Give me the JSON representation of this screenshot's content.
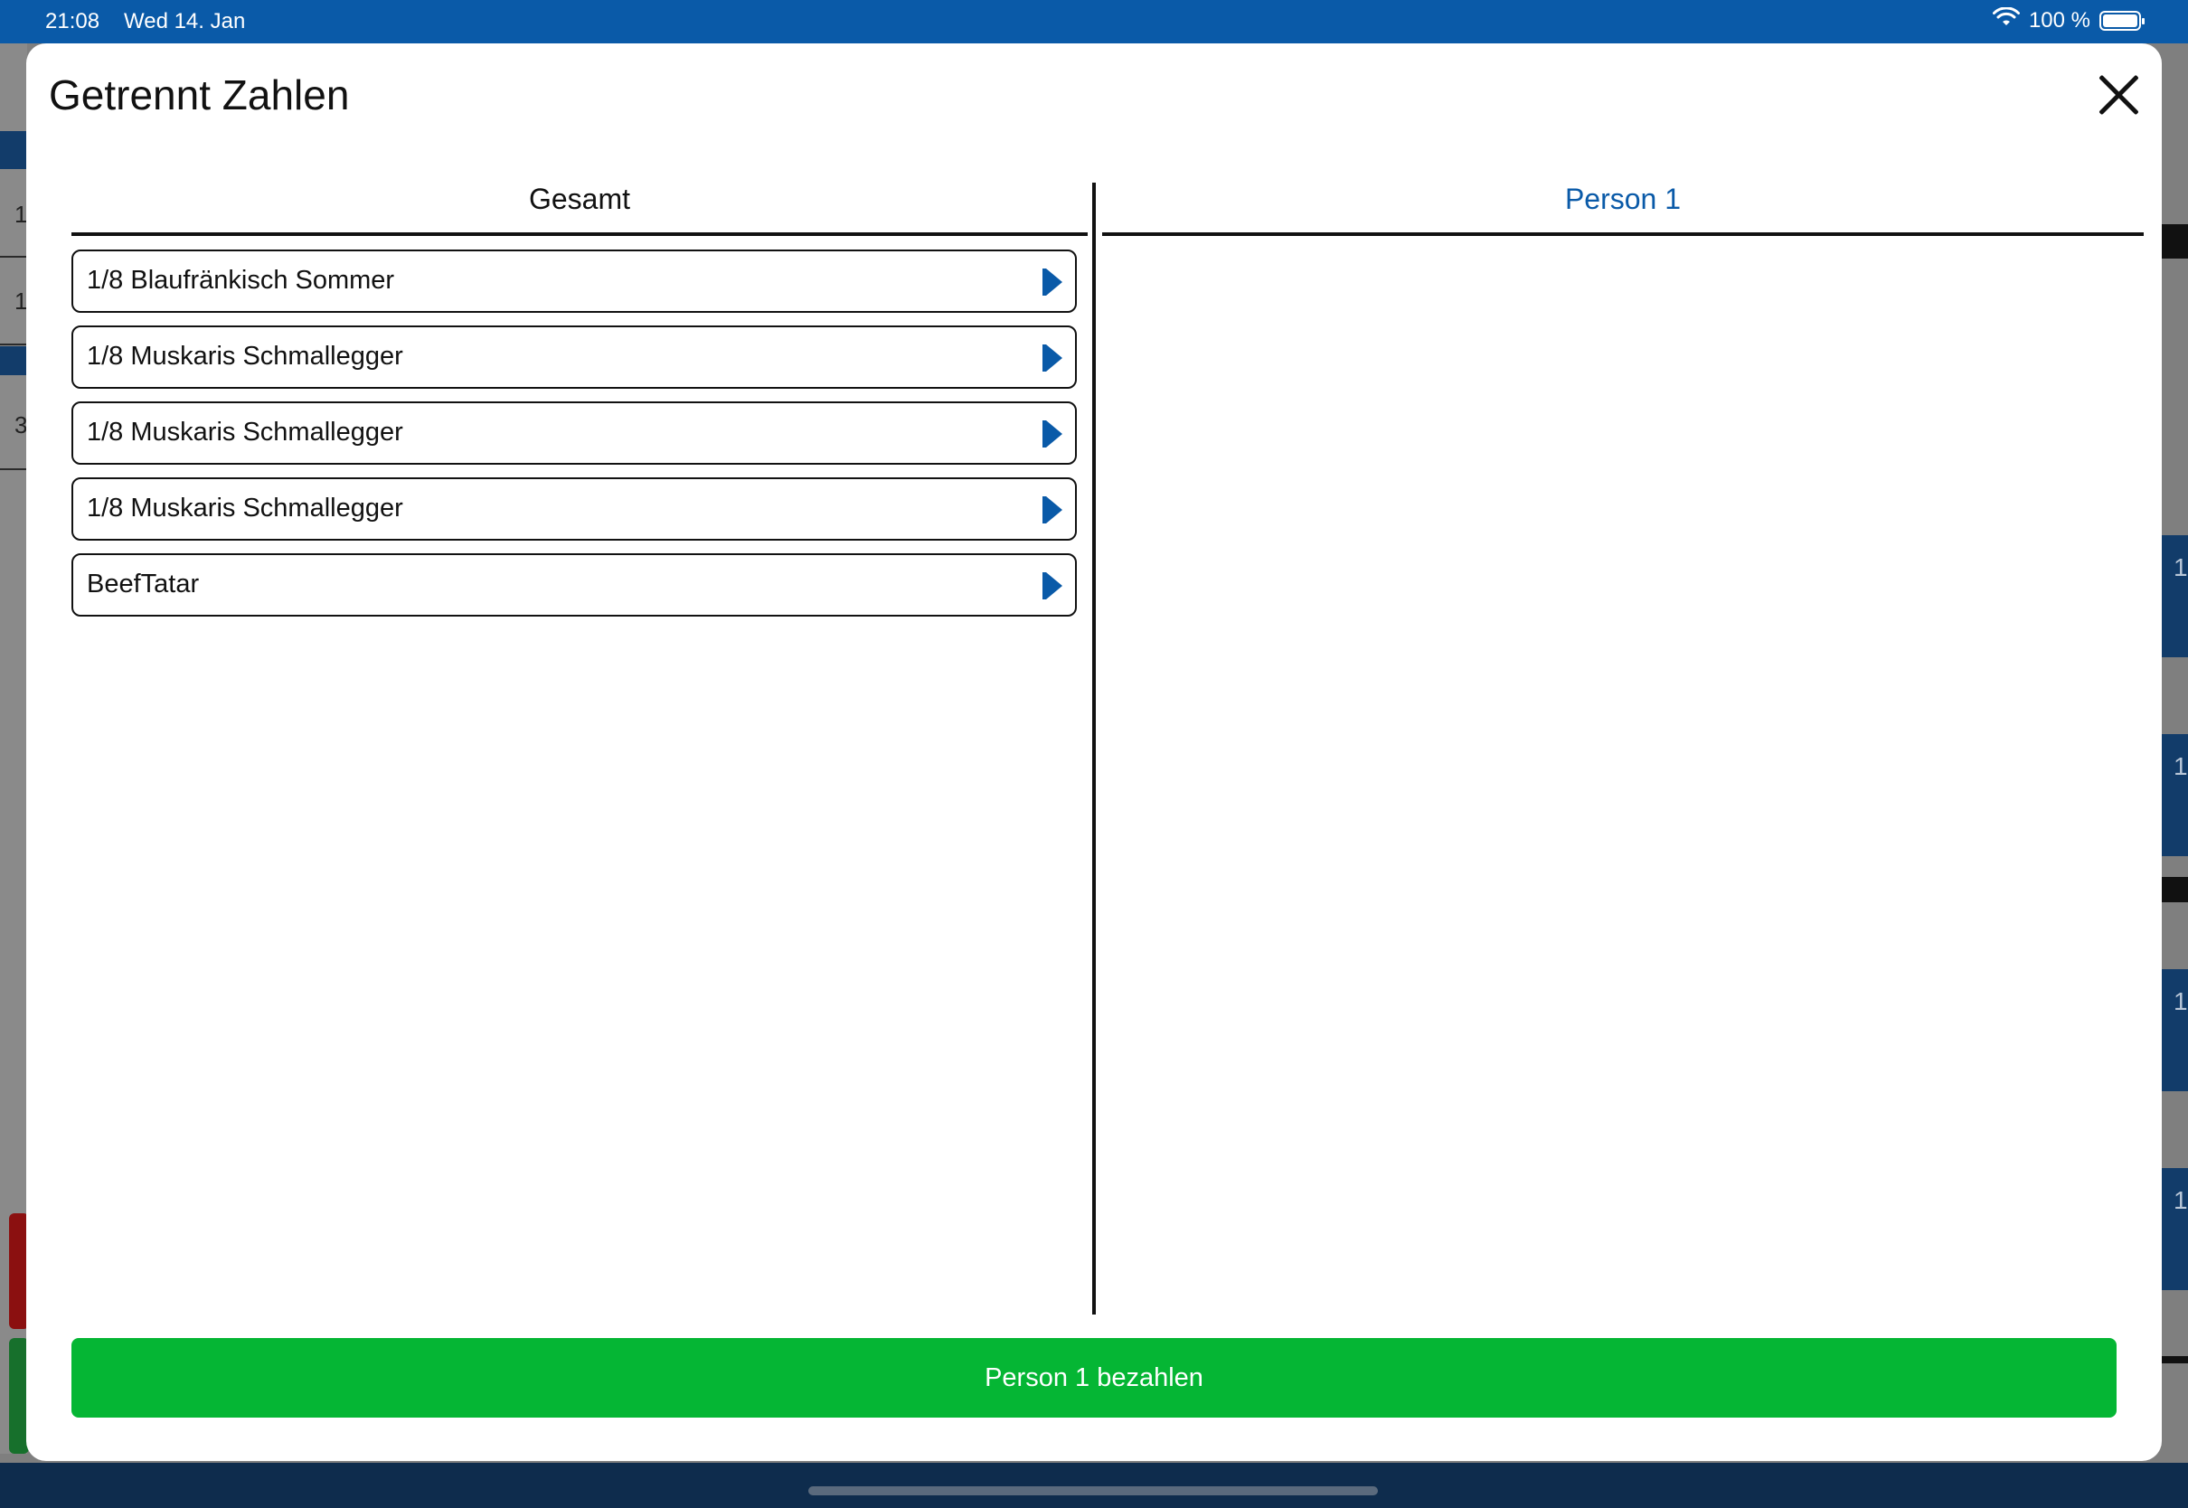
{
  "status_bar": {
    "time": "21:08",
    "date": "Wed 14. Jan",
    "battery": "100 %"
  },
  "background_app": {
    "left_numbers": [
      "1",
      "1",
      "3"
    ],
    "right_numbers": [
      "1",
      "1",
      "1",
      "1"
    ]
  },
  "modal": {
    "title": "Getrennt Zahlen",
    "columns": {
      "total_label": "Gesamt",
      "person_label": "Person 1"
    },
    "items": [
      {
        "label": "1/8 Blaufränkisch Sommer"
      },
      {
        "label": "1/8 Muskaris Schmallegger"
      },
      {
        "label": "1/8 Muskaris Schmallegger"
      },
      {
        "label": "1/8 Muskaris Schmallegger"
      },
      {
        "label": "BeefTatar"
      }
    ],
    "pay_button_label": "Person 1 bezahlen"
  },
  "colors": {
    "accent": "#0a5aa8",
    "pay_button": "#05b634",
    "modal_background": "#ffffff"
  },
  "icons": {
    "close": "close-icon",
    "move_item": "chevron-right-icon",
    "wifi": "wifi-icon",
    "battery": "battery-icon"
  }
}
